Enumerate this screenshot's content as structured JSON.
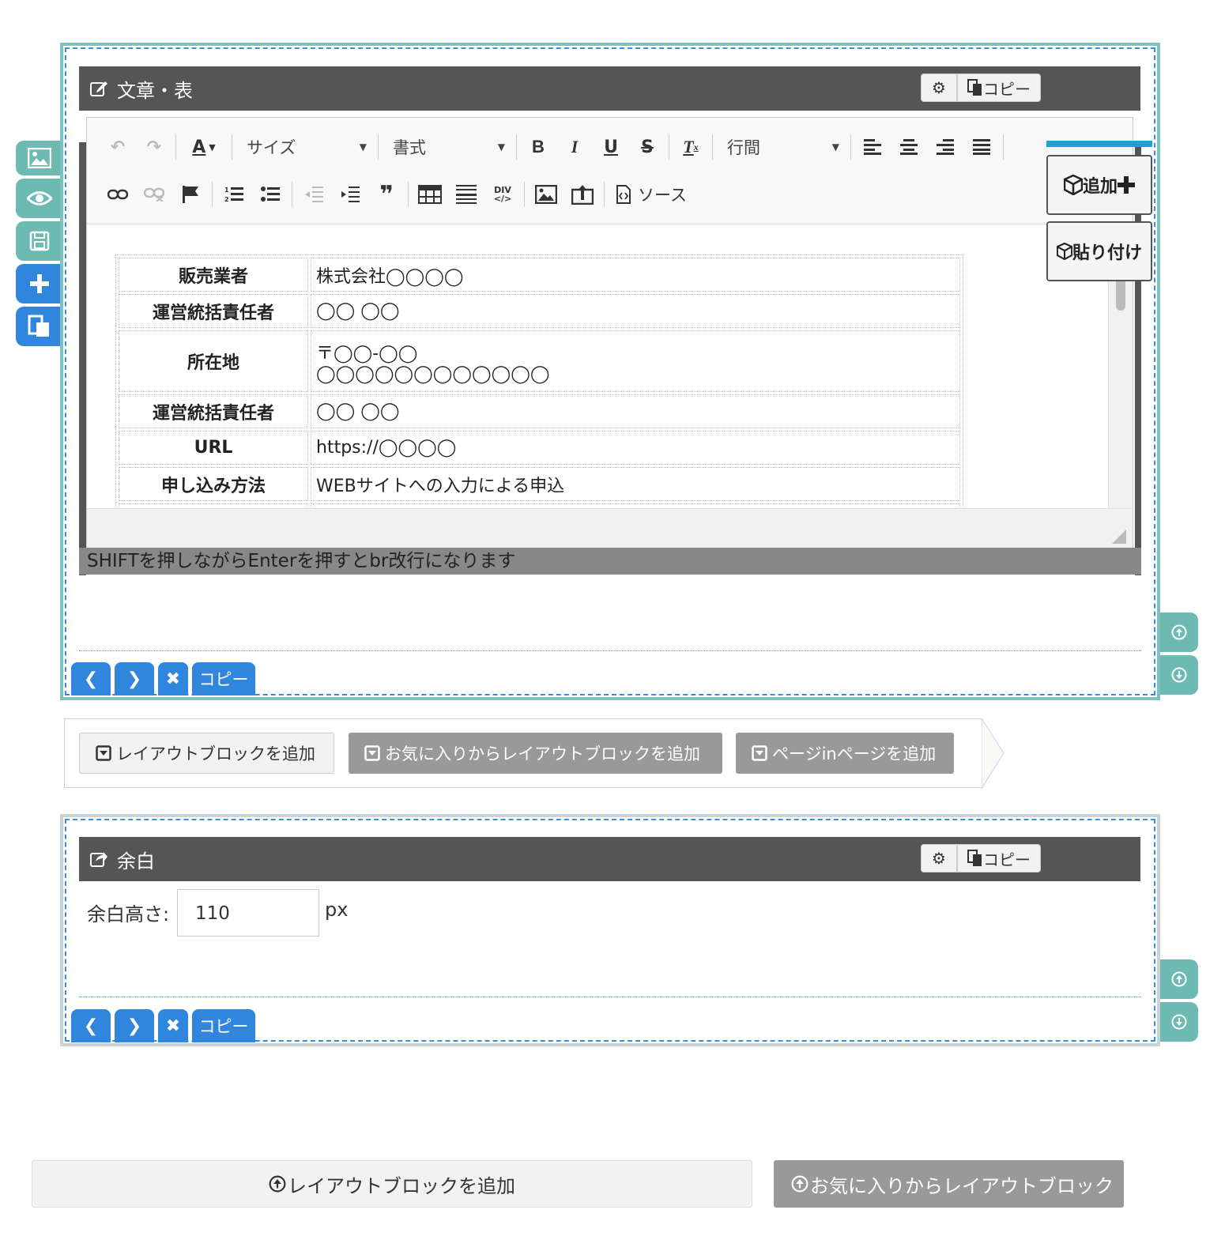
{
  "text_block": {
    "title": "文章・表",
    "copy_label": "コピー",
    "toolbar": {
      "size_label": "サイズ",
      "format_label": "書式",
      "line_height_label": "行間",
      "source_label": "ソース",
      "text_color_label": "A",
      "bold": "B",
      "italic": "I",
      "underline": "U",
      "strike": "S",
      "div_label": "DIV"
    },
    "table": [
      {
        "key": "販売業者",
        "value": "株式会社◯◯◯◯"
      },
      {
        "key": "運営統括責任者",
        "value": "◯◯ ◯◯"
      },
      {
        "key": "所在地",
        "value": "〒◯◯-◯◯",
        "value2": "◯◯◯◯◯◯◯◯◯◯◯◯"
      },
      {
        "key": "運営統括責任者",
        "value": "◯◯ ◯◯"
      },
      {
        "key": "URL",
        "value": "https://◯◯◯◯"
      },
      {
        "key": "申し込み方法",
        "value": "WEBサイトへの入力による申込"
      }
    ],
    "hint": "SHIFTを押しながらEnterを押すとbr改行になります",
    "float_add": "追加",
    "float_paste": "貼り付け",
    "nav_copy": "コピー"
  },
  "add_layout": {
    "add_block": "レイアウトブロックを追加",
    "add_fav": "お気に入りからレイアウトブロックを追加",
    "add_page": "ページinページを追加"
  },
  "space_block": {
    "title": "余白",
    "copy_label": "コピー",
    "height_label": "余白高さ:",
    "height_value": "110",
    "unit": "px",
    "nav_copy": "コピー"
  },
  "bottom": {
    "add_block": "レイアウトブロックを追加",
    "add_fav": "お気に入りからレイアウトブロック"
  },
  "colors": {
    "accent_blue": "#2f86dc",
    "teal": "#6dbab3",
    "header_dark": "#555555",
    "button_gray": "#999999"
  }
}
